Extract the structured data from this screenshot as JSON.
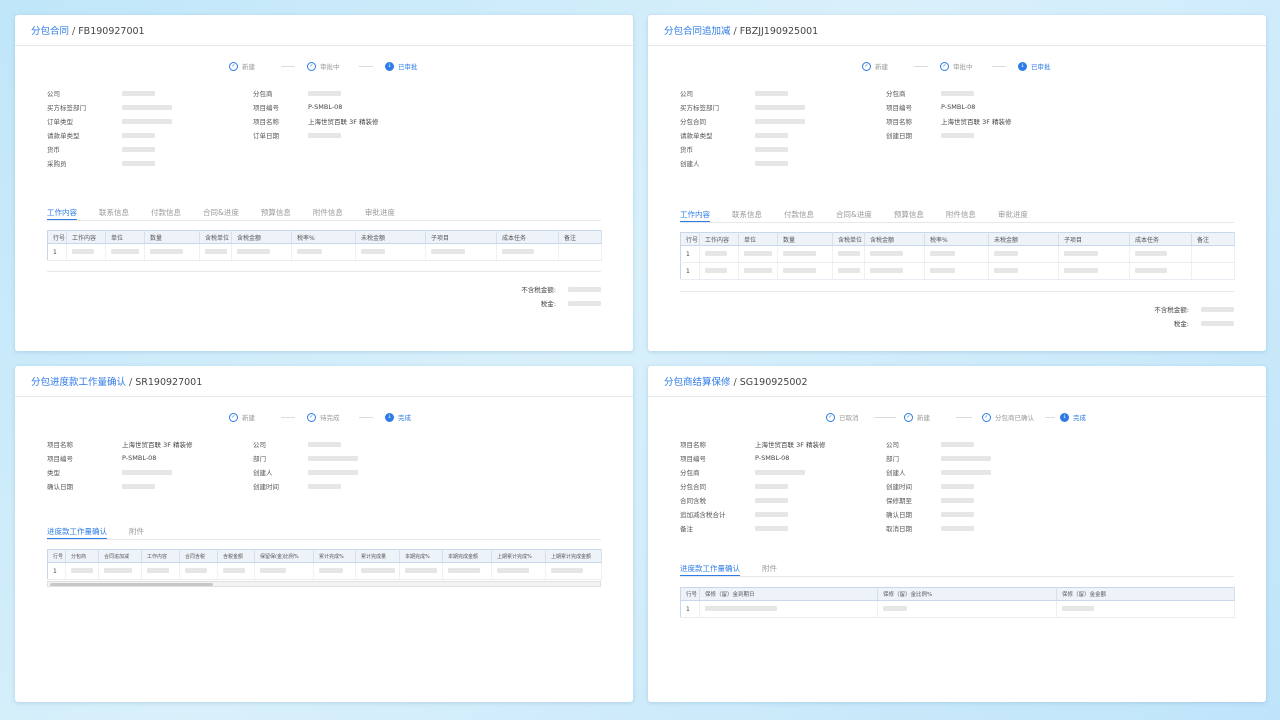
{
  "card1": {
    "breadcrumb": {
      "link": "分包合同",
      "sep": "/",
      "code": "FB190927001"
    },
    "steps": [
      "新建",
      "审批中",
      "已审批"
    ],
    "left_fields": [
      "公司",
      "买方标签部门",
      "订单类型",
      "请款单类型",
      "货币",
      "采购员"
    ],
    "right_fields": [
      {
        "label": "分包商",
        "value": ""
      },
      {
        "label": "项目编号",
        "value": "P-SMBL-08"
      },
      {
        "label": "项目名称",
        "value": "上海世贸百联 3F 精装修"
      },
      {
        "label": "订单日期",
        "value": ""
      }
    ],
    "tabs": [
      "工作内容",
      "联系信息",
      "付款信息",
      "合同&进度",
      "预算信息",
      "附件信息",
      "审批进度"
    ],
    "columns": [
      "行号",
      "工作内容",
      "单位",
      "数量",
      "含税单位",
      "含税金额",
      "税率%",
      "未税金额",
      "子项目",
      "成本任务",
      "备注"
    ],
    "rows": [
      "1"
    ],
    "summary": [
      "不含税金额:",
      "税金:"
    ]
  },
  "card2": {
    "breadcrumb": {
      "link": "分包合同追加减",
      "sep": "/",
      "code": "FBZJJ190925001"
    },
    "steps": [
      "新建",
      "审批中",
      "已审批"
    ],
    "left_fields": [
      "公司",
      "买方标签部门",
      "分包合同",
      "请款单类型",
      "货币",
      "创建人"
    ],
    "right_fields": [
      {
        "label": "分包商",
        "value": ""
      },
      {
        "label": "项目编号",
        "value": "P-SMBL-08"
      },
      {
        "label": "项目名称",
        "value": "上海世贸百联 3F 精装修"
      },
      {
        "label": "创建日期",
        "value": ""
      }
    ],
    "tabs": [
      "工作内容",
      "联系信息",
      "付款信息",
      "合同&进度",
      "预算信息",
      "附件信息",
      "审批进度"
    ],
    "columns": [
      "行号",
      "工作内容",
      "单位",
      "数量",
      "含税单位",
      "含税金额",
      "税率%",
      "未税金额",
      "子项目",
      "成本任务",
      "备注"
    ],
    "rows": [
      "1",
      "1"
    ],
    "summary": [
      "不含税金额:",
      "税金:"
    ]
  },
  "card3": {
    "breadcrumb": {
      "link": "分包进度款工作量确认",
      "sep": "/",
      "code": "SR190927001"
    },
    "steps": [
      "新建",
      "待完成",
      "完成"
    ],
    "left_fields": [
      {
        "label": "项目名称",
        "value": "上海世贸百联 3F 精装修"
      },
      {
        "label": "项目编号",
        "value": "P-SMBL-08"
      },
      {
        "label": "类型",
        "value": ""
      },
      {
        "label": "确认日期",
        "value": ""
      }
    ],
    "right_fields": [
      "公司",
      "部门",
      "创建人",
      "创建时间"
    ],
    "tabs": [
      "进度款工作量确认",
      "附件"
    ],
    "columns": [
      "行号",
      "分包商",
      "合同追加减",
      "工作内容",
      "合同含税",
      "含税金额",
      "保留保(金)比例%",
      "累计完成%",
      "累计完成量",
      "本期完成%",
      "本期完成金额",
      "上期累计完成%",
      "上期累计完成金额"
    ],
    "rows": [
      "1"
    ]
  },
  "card4": {
    "breadcrumb": {
      "link": "分包商结算保修",
      "sep": "/",
      "code": "SG190925002"
    },
    "steps": [
      "已取消",
      "新建",
      "分包商已确认",
      "完成"
    ],
    "left_fields": [
      {
        "label": "项目名称",
        "value": "上海世贸百联 3F 精装修"
      },
      {
        "label": "项目编号",
        "value": "P-SMBL-08"
      },
      {
        "label": "分包商",
        "value": ""
      },
      {
        "label": "分包合同",
        "value": ""
      },
      {
        "label": "合同含税",
        "value": ""
      },
      {
        "label": "追加减含税合计",
        "value": ""
      },
      {
        "label": "备注",
        "value": ""
      }
    ],
    "right_fields": [
      "公司",
      "部门",
      "创建人",
      "创建时间",
      "保修期至",
      "确认日期",
      "取消日期"
    ],
    "tabs": [
      "进度款工作量确认",
      "附件"
    ],
    "columns": [
      "行号",
      "保修（留）金到期日",
      "保修（留）金比例%",
      "保修（留）金金额"
    ],
    "rows": [
      "1"
    ]
  },
  "colors": {
    "accent": "#2e7be6",
    "skeleton": "#e6e6e6",
    "header_bg": "#eef3fa"
  },
  "icons": {
    "step_done": "check-circle-icon",
    "step_current": "current-step-icon"
  }
}
